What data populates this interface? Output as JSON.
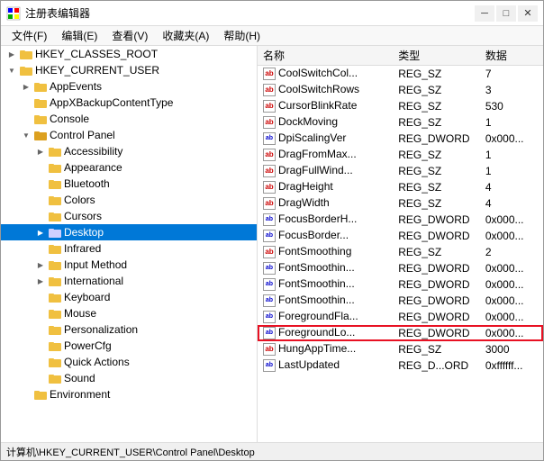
{
  "window": {
    "title": "注册表编辑器",
    "controls": {
      "minimize": "─",
      "maximize": "□",
      "close": "✕"
    }
  },
  "menu": {
    "items": [
      "文件(F)",
      "编辑(E)",
      "查看(V)",
      "收藏夹(A)",
      "帮助(H)"
    ]
  },
  "tree": {
    "items": [
      {
        "id": "hkcr",
        "label": "HKEY_CLASSES_ROOT",
        "level": 1,
        "expanded": false,
        "selected": false
      },
      {
        "id": "hkcu",
        "label": "HKEY_CURRENT_USER",
        "level": 1,
        "expanded": true,
        "selected": false
      },
      {
        "id": "appevents",
        "label": "AppEvents",
        "level": 2,
        "expanded": false,
        "selected": false
      },
      {
        "id": "appxbackup",
        "label": "AppXBackupContentType",
        "level": 2,
        "expanded": false,
        "selected": false
      },
      {
        "id": "console",
        "label": "Console",
        "level": 2,
        "expanded": false,
        "selected": false
      },
      {
        "id": "controlpanel",
        "label": "Control Panel",
        "level": 2,
        "expanded": true,
        "selected": false
      },
      {
        "id": "accessibility",
        "label": "Accessibility",
        "level": 3,
        "expanded": false,
        "selected": false
      },
      {
        "id": "appearance",
        "label": "Appearance",
        "level": 3,
        "expanded": false,
        "selected": false
      },
      {
        "id": "bluetooth",
        "label": "Bluetooth",
        "level": 3,
        "expanded": false,
        "selected": false
      },
      {
        "id": "colors",
        "label": "Colors",
        "level": 3,
        "expanded": false,
        "selected": false
      },
      {
        "id": "cursors",
        "label": "Cursors",
        "level": 3,
        "expanded": false,
        "selected": false
      },
      {
        "id": "desktop",
        "label": "Desktop",
        "level": 3,
        "expanded": false,
        "selected": true
      },
      {
        "id": "infrared",
        "label": "Infrared",
        "level": 3,
        "expanded": false,
        "selected": false
      },
      {
        "id": "inputmethod",
        "label": "Input Method",
        "level": 3,
        "expanded": false,
        "selected": false
      },
      {
        "id": "international",
        "label": "International",
        "level": 3,
        "expanded": false,
        "selected": false
      },
      {
        "id": "keyboard",
        "label": "Keyboard",
        "level": 3,
        "expanded": false,
        "selected": false
      },
      {
        "id": "mouse",
        "label": "Mouse",
        "level": 3,
        "expanded": false,
        "selected": false
      },
      {
        "id": "personalization",
        "label": "Personalization",
        "level": 3,
        "expanded": false,
        "selected": false
      },
      {
        "id": "powercfg",
        "label": "PowerCfg",
        "level": 3,
        "expanded": false,
        "selected": false
      },
      {
        "id": "quickactions",
        "label": "Quick Actions",
        "level": 3,
        "expanded": false,
        "selected": false
      },
      {
        "id": "sound",
        "label": "Sound",
        "level": 3,
        "expanded": false,
        "selected": false
      },
      {
        "id": "environment",
        "label": "Environment",
        "level": 2,
        "expanded": false,
        "selected": false
      }
    ]
  },
  "table": {
    "headers": [
      "名称",
      "类型",
      "数据"
    ],
    "rows": [
      {
        "name": "CoolSwitchCol...",
        "type": "REG_SZ",
        "data": "7",
        "highlighted": false,
        "selected": false,
        "iconType": "ab"
      },
      {
        "name": "CoolSwitchRows",
        "type": "REG_SZ",
        "data": "3",
        "highlighted": false,
        "selected": false,
        "iconType": "ab"
      },
      {
        "name": "CursorBlinkRate",
        "type": "REG_SZ",
        "data": "530",
        "highlighted": false,
        "selected": false,
        "iconType": "ab"
      },
      {
        "name": "DockMoving",
        "type": "REG_SZ",
        "data": "1",
        "highlighted": false,
        "selected": false,
        "iconType": "ab"
      },
      {
        "name": "DpiScalingVer",
        "type": "REG_DWORD",
        "data": "0x000...",
        "highlighted": false,
        "selected": false,
        "iconType": "dword"
      },
      {
        "name": "DragFromMax...",
        "type": "REG_SZ",
        "data": "1",
        "highlighted": false,
        "selected": false,
        "iconType": "ab"
      },
      {
        "name": "DragFullWind...",
        "type": "REG_SZ",
        "data": "1",
        "highlighted": false,
        "selected": false,
        "iconType": "ab"
      },
      {
        "name": "DragHeight",
        "type": "REG_SZ",
        "data": "4",
        "highlighted": false,
        "selected": false,
        "iconType": "ab"
      },
      {
        "name": "DragWidth",
        "type": "REG_SZ",
        "data": "4",
        "highlighted": false,
        "selected": false,
        "iconType": "ab"
      },
      {
        "name": "FocusBorderH...",
        "type": "REG_DWORD",
        "data": "0x000...",
        "highlighted": false,
        "selected": false,
        "iconType": "dword"
      },
      {
        "name": "FocusBorder...",
        "type": "REG_DWORD",
        "data": "0x000...",
        "highlighted": false,
        "selected": false,
        "iconType": "dword"
      },
      {
        "name": "FontSmoothing",
        "type": "REG_SZ",
        "data": "2",
        "highlighted": false,
        "selected": false,
        "iconType": "ab"
      },
      {
        "name": "FontSmoothin...",
        "type": "REG_DWORD",
        "data": "0x000...",
        "highlighted": false,
        "selected": false,
        "iconType": "dword"
      },
      {
        "name": "FontSmoothin...",
        "type": "REG_DWORD",
        "data": "0x000...",
        "highlighted": false,
        "selected": false,
        "iconType": "dword"
      },
      {
        "name": "FontSmoothin...",
        "type": "REG_DWORD",
        "data": "0x000...",
        "highlighted": false,
        "selected": false,
        "iconType": "dword"
      },
      {
        "name": "ForegroundFla...",
        "type": "REG_DWORD",
        "data": "0x000...",
        "highlighted": false,
        "selected": false,
        "iconType": "dword"
      },
      {
        "name": "ForegroundLo...",
        "type": "REG_DWORD",
        "data": "0x000...",
        "highlighted": true,
        "selected": false,
        "iconType": "dword"
      },
      {
        "name": "HungAppTime...",
        "type": "REG_SZ",
        "data": "3000",
        "highlighted": false,
        "selected": false,
        "iconType": "ab"
      },
      {
        "name": "LastUpdated",
        "type": "REG_D...ORD",
        "data": "0xffffff...",
        "highlighted": false,
        "selected": false,
        "iconType": "dword"
      }
    ]
  },
  "statusbar": {
    "text": "计算机\\HKEY_CURRENT_USER\\Control Panel\\Desktop"
  },
  "colors": {
    "selected_bg": "#0078d7",
    "highlight_border": "#e81123",
    "hover_bg": "#cce8ff"
  }
}
